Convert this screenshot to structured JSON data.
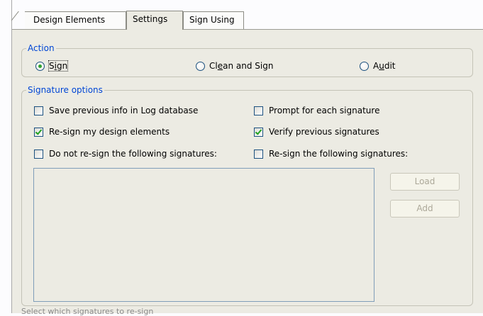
{
  "tabs": [
    {
      "label": "Design Elements",
      "active": false
    },
    {
      "label": "Settings",
      "active": true
    },
    {
      "label": "Sign Using",
      "active": false
    }
  ],
  "action": {
    "legend": "Action",
    "options": [
      {
        "label": "Sign",
        "mnemonic_index": 1,
        "selected": true
      },
      {
        "label": "Clean and Sign",
        "mnemonic_index": 2,
        "selected": false
      },
      {
        "label": "Audit",
        "mnemonic_index": 1,
        "selected": false
      }
    ]
  },
  "signature_options": {
    "legend": "Signature options",
    "checkboxes": [
      {
        "label": "Save previous info in Log database",
        "checked": false
      },
      {
        "label": "Prompt for each signature",
        "checked": false
      },
      {
        "label": "Re-sign my design elements",
        "checked": true
      },
      {
        "label": "Verify previous signatures",
        "checked": true
      },
      {
        "label": "Do not re-sign the following signatures:",
        "checked": false
      },
      {
        "label": "Re-sign the following signatures:",
        "checked": false
      }
    ],
    "buttons": {
      "load": "Load",
      "add": "Add"
    }
  },
  "status_text": "Select which signatures to re-sign",
  "colors": {
    "accent": "#0046d5",
    "check": "#21a121",
    "panel": "#ecebe3"
  }
}
